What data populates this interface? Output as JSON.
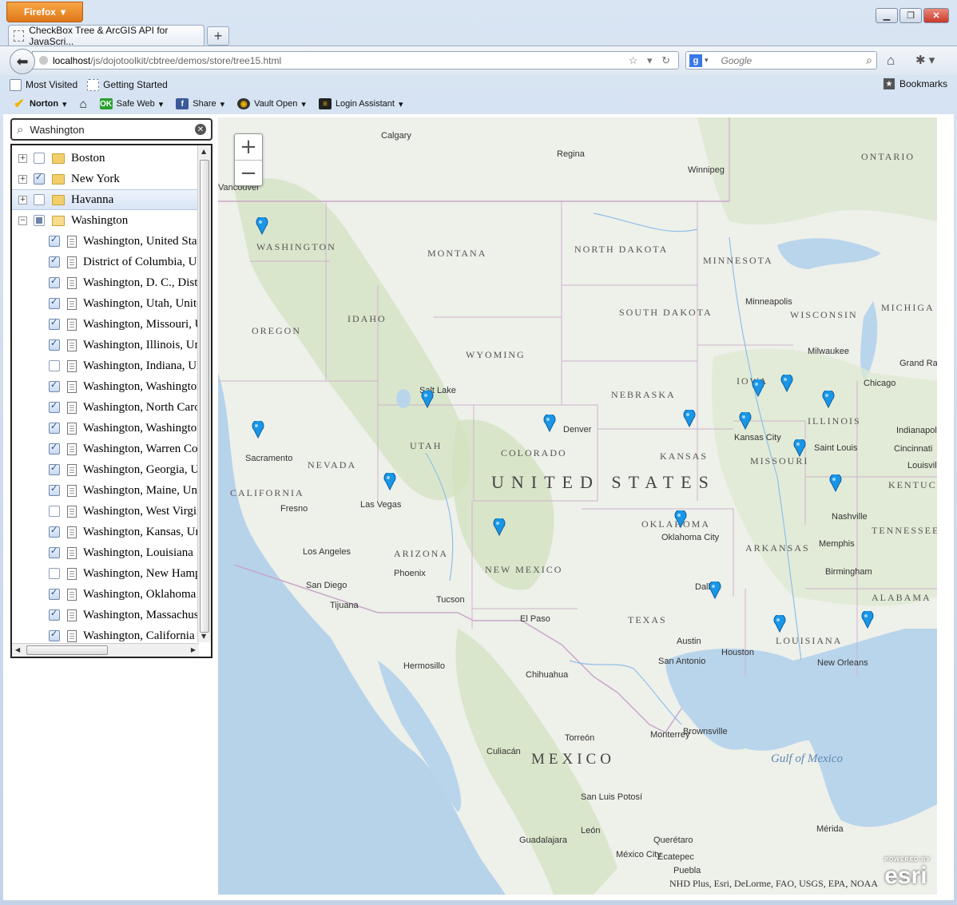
{
  "browser": {
    "menu_button": "Firefox",
    "tab_title": "CheckBox Tree & ArcGIS API for JavaScri...",
    "url_host": "localhost",
    "url_path": "/js/dojotoolkit/cbtree/demos/store/tree15.html",
    "search_placeholder": "Google",
    "search_engine_letter": "g",
    "bookmarks": [
      "Most Visited",
      "Getting Started"
    ],
    "bookmarks_menu": "Bookmarks",
    "toolbar": {
      "norton": "Norton",
      "safe_web": "Safe Web",
      "safe_web_badge": "OK",
      "share": "Share",
      "vault_open": "Vault Open",
      "login_assistant": "Login Assistant"
    }
  },
  "filter": {
    "value": "Washington"
  },
  "tree": {
    "rows": [
      {
        "label": "Boston",
        "type": "folder",
        "checked": "none",
        "expand": "+"
      },
      {
        "label": "New York",
        "type": "folder",
        "checked": "on",
        "expand": "+"
      },
      {
        "label": "Havanna",
        "type": "folder",
        "checked": "none",
        "expand": "+",
        "selected": true
      },
      {
        "label": "Washington",
        "type": "folder-open",
        "checked": "mixed",
        "expand": "−"
      },
      {
        "label": "Washington, United States",
        "type": "doc",
        "checked": "on"
      },
      {
        "label": "District of Columbia, United States",
        "type": "doc",
        "checked": "on"
      },
      {
        "label": "Washington, D. C., District of Columbia",
        "type": "doc",
        "checked": "on"
      },
      {
        "label": "Washington, Utah, United States",
        "type": "doc",
        "checked": "on"
      },
      {
        "label": "Washington, Missouri, United States",
        "type": "doc",
        "checked": "on"
      },
      {
        "label": "Washington, Illinois, United States",
        "type": "doc",
        "checked": "on"
      },
      {
        "label": "Washington, Indiana, United States",
        "type": "doc",
        "checked": "none"
      },
      {
        "label": "Washington, Washington",
        "type": "doc",
        "checked": "on"
      },
      {
        "label": "Washington, North Carolina",
        "type": "doc",
        "checked": "on"
      },
      {
        "label": "Washington, Washington",
        "type": "doc",
        "checked": "on"
      },
      {
        "label": "Washington, Warren County",
        "type": "doc",
        "checked": "on"
      },
      {
        "label": "Washington, Georgia, United States",
        "type": "doc",
        "checked": "on"
      },
      {
        "label": "Washington, Maine, United States",
        "type": "doc",
        "checked": "on"
      },
      {
        "label": "Washington, West Virginia",
        "type": "doc",
        "checked": "none"
      },
      {
        "label": "Washington, Kansas, United States",
        "type": "doc",
        "checked": "on"
      },
      {
        "label": "Washington, Louisiana",
        "type": "doc",
        "checked": "on"
      },
      {
        "label": "Washington, New Hampshire",
        "type": "doc",
        "checked": "none"
      },
      {
        "label": "Washington, Oklahoma",
        "type": "doc",
        "checked": "on"
      },
      {
        "label": "Washington, Massachusetts",
        "type": "doc",
        "checked": "on"
      },
      {
        "label": "Washington, California",
        "type": "doc",
        "checked": "on"
      }
    ]
  },
  "map": {
    "zoom_in": "+",
    "zoom_out": "−",
    "attribution": "NHD Plus, Esri, DeLorme, FAO, USGS, EPA, NOAA",
    "logo_top": "POWERED BY",
    "logo": "esri",
    "labels": {
      "country_us": "UNITED STATES",
      "country_mx": "MEXICO",
      "ontario": "ONTARIO",
      "gulf": "Gulf of Mexico",
      "states": [
        "WASHINGTON",
        "OREGON",
        "CALIFORNIA",
        "NEVADA",
        "IDAHO",
        "MONTANA",
        "WYOMING",
        "UTAH",
        "COLORADO",
        "ARIZONA",
        "NEW MEXICO",
        "NORTH DAKOTA",
        "SOUTH DAKOTA",
        "NEBRASKA",
        "KANSAS",
        "OKLAHOMA",
        "TEXAS",
        "MINNESOTA",
        "IOWA",
        "MISSOURI",
        "ARKANSAS",
        "LOUISIANA",
        "WISCONSIN",
        "ILLINOIS",
        "MICHIGA",
        "TENNESSEE",
        "ALABAMA",
        "KENTUC"
      ],
      "cities": [
        "Calgary",
        "Regina",
        "Winnipeg",
        "Vancouver",
        "Salt Lake",
        "Denver",
        "Sacramento",
        "Fresno",
        "Las Vegas",
        "Los Angeles",
        "San Diego",
        "Tijuana",
        "Phoenix",
        "Tucson",
        "El Paso",
        "Dallas",
        "Austin",
        "Houston",
        "San Antonio",
        "Oklahoma City",
        "Kansas City",
        "Saint Louis",
        "Chicago",
        "Minneapolis",
        "Milwaukee",
        "Indianapolis",
        "Cincinnati",
        "Louisville",
        "Nashville",
        "Memphis",
        "Birmingham",
        "New Orleans",
        "Grand Rapids",
        "Hermosillo",
        "Chihuahua",
        "Monterrey",
        "Torreón",
        "Culiacán",
        "San Luis Potosí",
        "León",
        "Guadalajara",
        "Querétaro",
        "México City",
        "Ecatepec",
        "Puebla",
        "Mérida",
        "Brownsville"
      ]
    }
  }
}
